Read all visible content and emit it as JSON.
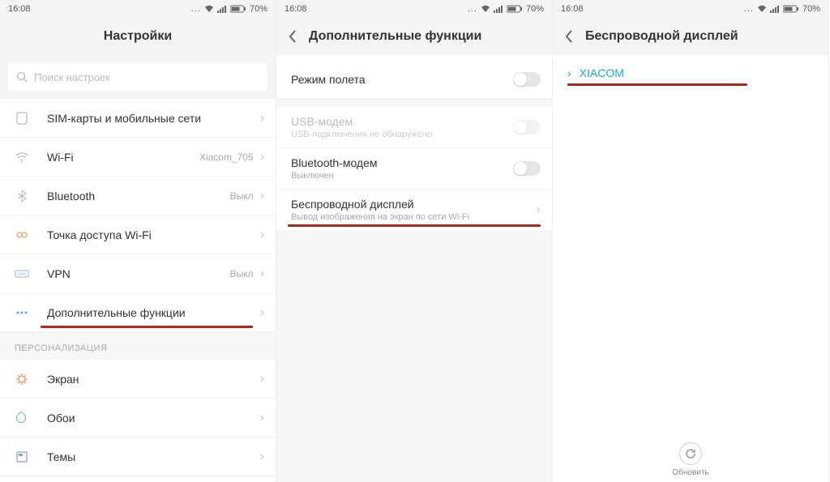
{
  "status": {
    "time": "16:08",
    "battery": "70%"
  },
  "icons": {
    "search": "⌕",
    "chevron": "›",
    "back": "‹",
    "dots": "..."
  },
  "screen1": {
    "title": "Настройки",
    "search_placeholder": "Поиск настроек",
    "rows": {
      "sim": {
        "label": "SIM-карты и мобильные сети"
      },
      "wifi": {
        "label": "Wi-Fi",
        "value": "Xiacom_705"
      },
      "bt": {
        "label": "Bluetooth",
        "value": "Выкл"
      },
      "hotspot": {
        "label": "Точка доступа Wi-Fi"
      },
      "vpn": {
        "label": "VPN",
        "value": "Выкл"
      },
      "more": {
        "label": "Дополнительные функции"
      }
    },
    "section_personalization": "ПЕРСОНАЛИЗАЦИЯ",
    "rows2": {
      "display": {
        "label": "Экран"
      },
      "wall": {
        "label": "Обои"
      },
      "themes": {
        "label": "Темы"
      }
    }
  },
  "screen2": {
    "title": "Дополнительные функции",
    "rows": {
      "airplane": {
        "label": "Режим полета"
      },
      "usb": {
        "label": "USB-модем",
        "sub": "USB-подключения не обнаружено"
      },
      "btmodem": {
        "label": "Bluetooth-модем",
        "sub": "Выключен"
      },
      "wdisplay": {
        "label": "Беспроводной дисплей",
        "sub": "Вывод изображения на экран по сети Wi-Fi"
      }
    }
  },
  "screen3": {
    "title": "Беспроводной дисплей",
    "device": "XIACOM",
    "refresh": "Обновить"
  }
}
